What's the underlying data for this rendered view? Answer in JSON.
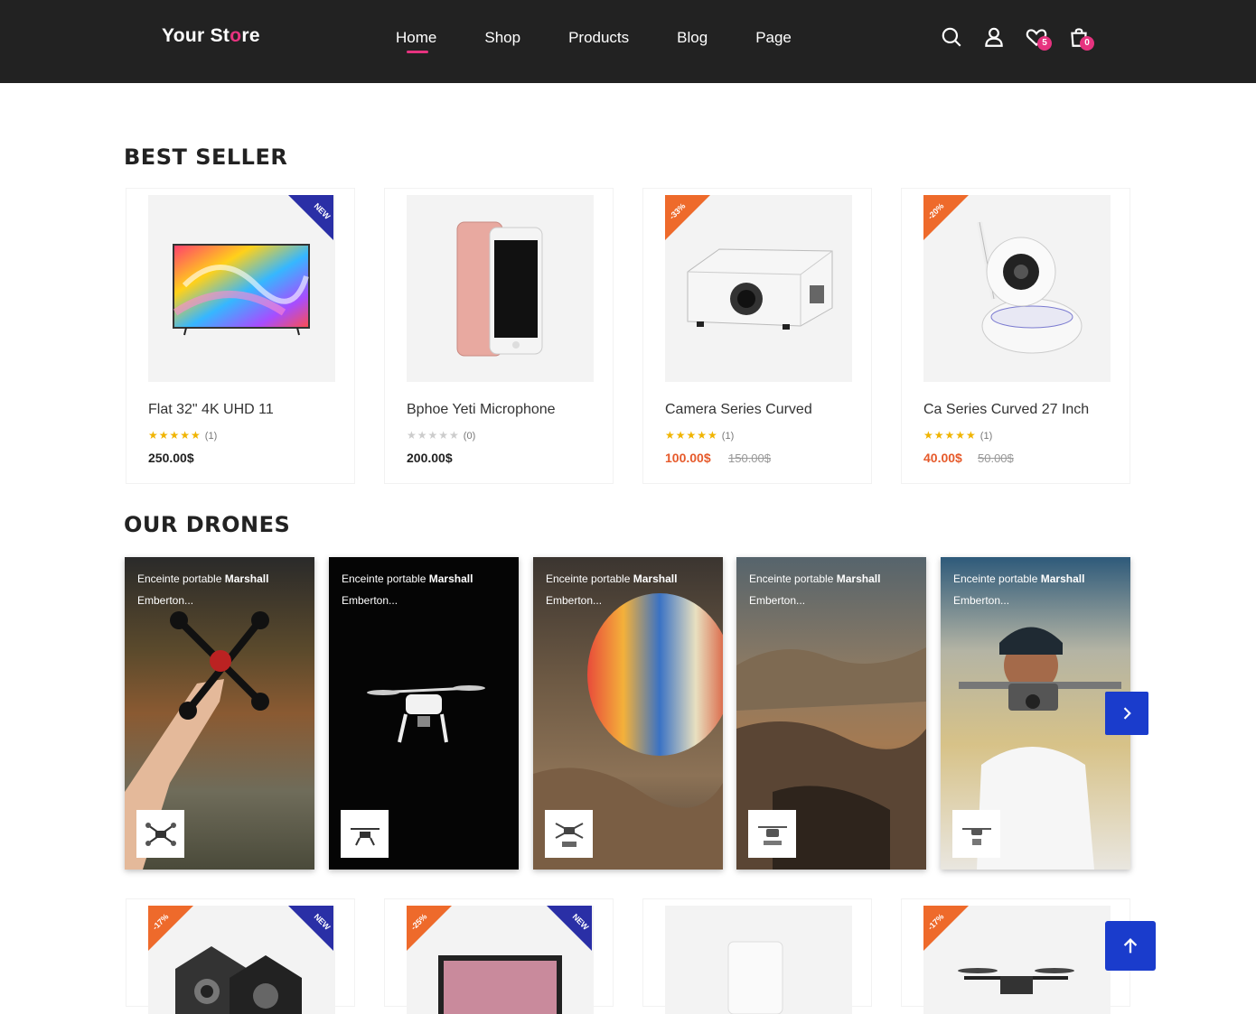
{
  "header": {
    "logo_pre": "Your St",
    "logo_o": "o",
    "logo_post": "re",
    "nav": [
      "Home",
      "Shop",
      "Products",
      "Blog",
      "Page"
    ],
    "active_nav": "Home",
    "wishlist_count": "5",
    "cart_count": "0"
  },
  "best_seller": {
    "title": "BEST SELLER",
    "products": [
      {
        "name": "Flat 32\" 4K UHD 11",
        "stars": "★★★★★",
        "rating_count": "(1)",
        "price": "250.00$",
        "old_price": "",
        "ribbon": "NEW"
      },
      {
        "name": "Bphoe Yeti Microphone",
        "stars": "★★★★★",
        "rating_count": "(0)",
        "price": "200.00$",
        "old_price": "",
        "ribbon": ""
      },
      {
        "name": "Camera Series Curved",
        "stars": "★★★★★",
        "rating_count": "(1)",
        "price": "100.00$",
        "old_price": "150.00$",
        "ribbon": "-33%"
      },
      {
        "name": "Ca Series Curved 27 Inch",
        "stars": "★★★★★",
        "rating_count": "(1)",
        "price": "40.00$",
        "old_price": "50.00$",
        "ribbon": "-20%"
      }
    ]
  },
  "drones": {
    "title": "OUR DRONES",
    "caption_text": "Enceinte portable ",
    "caption_bold": "Marshall",
    "caption_line2": "Emberton...",
    "items": 5
  },
  "bottom_ribbons": [
    "-17%",
    "NEW",
    "-25%",
    "NEW",
    "-17%"
  ],
  "colors": {
    "header_bg": "#222222",
    "accent_pink": "#e6337f",
    "ribbon_new": "#2a2fa6",
    "ribbon_sale": "#ee6a2b",
    "button_blue": "#1a3ccc",
    "star": "#f0b400"
  },
  "icons": [
    "search-icon",
    "user-icon",
    "heart-icon",
    "bag-icon",
    "chevron-right-icon",
    "arrow-up-icon"
  ]
}
